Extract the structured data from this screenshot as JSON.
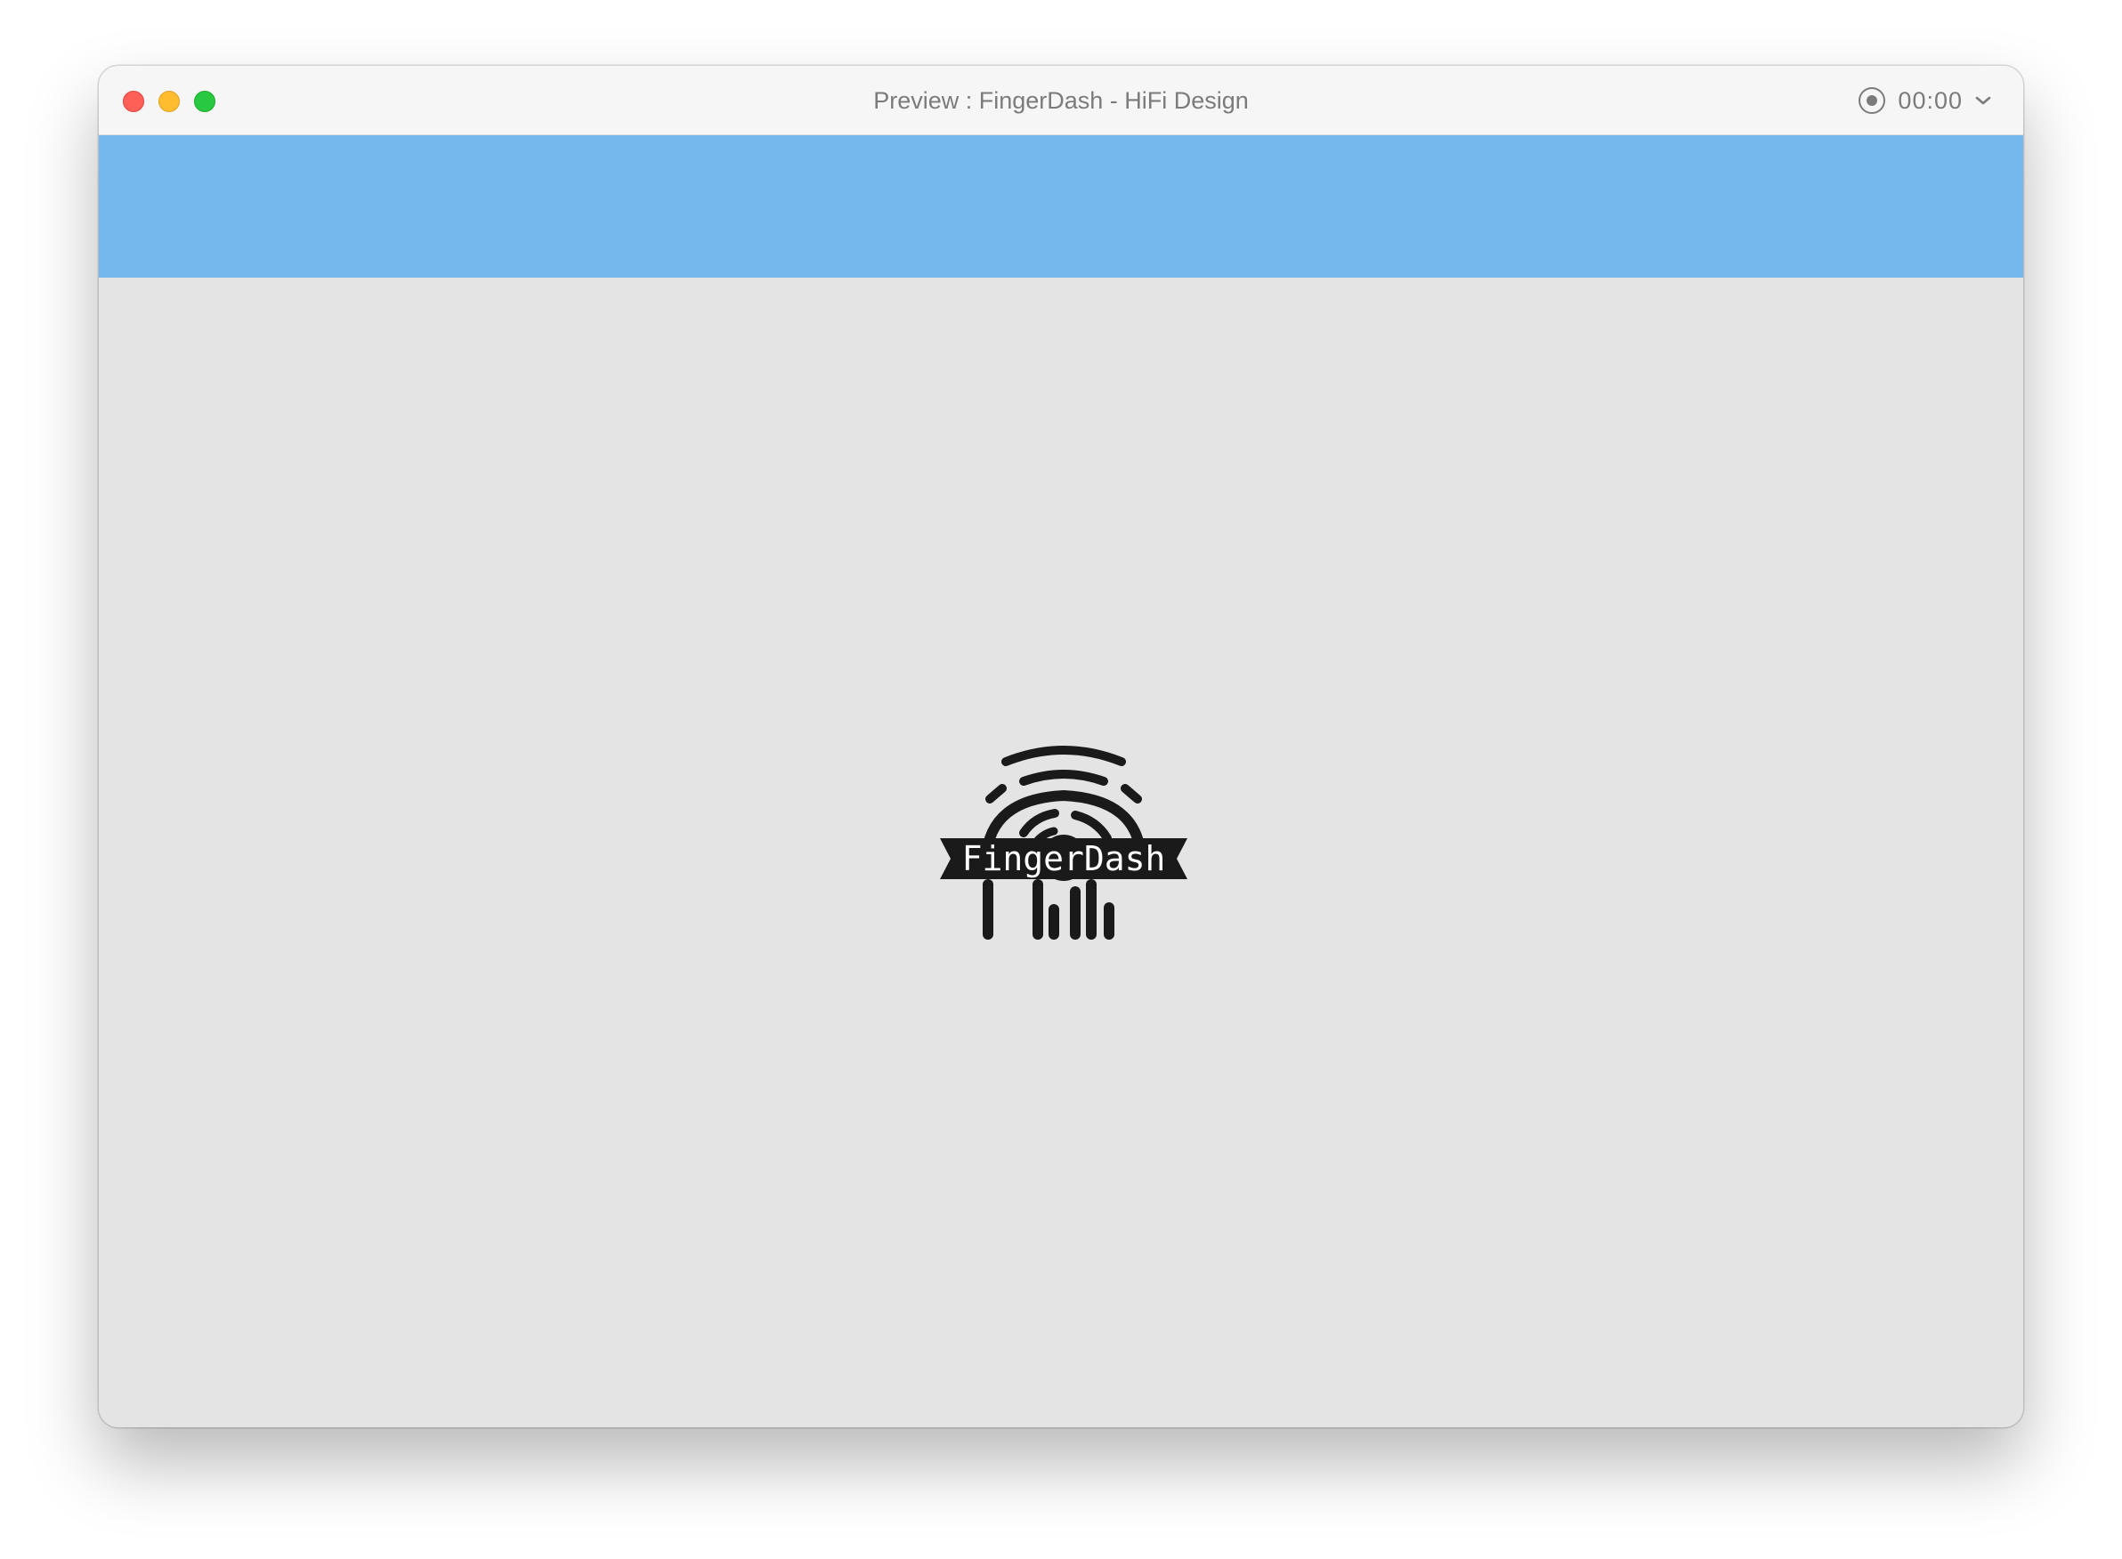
{
  "window": {
    "title": "Preview : FingerDash - HiFi Design",
    "recording_time": "00:00"
  },
  "banner": {
    "color": "#75b8ed"
  },
  "logo": {
    "text": "FingerDash",
    "icon": "fingerprint-icon"
  }
}
